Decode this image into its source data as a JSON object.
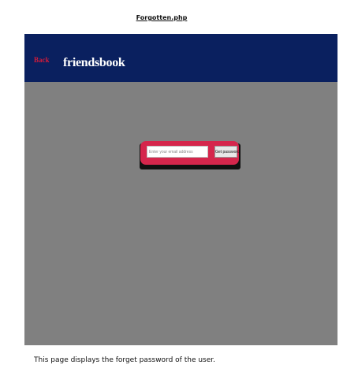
{
  "document": {
    "title": "Forgotten.php",
    "caption": "This page displays the forget password of the user."
  },
  "app": {
    "header": {
      "back_label": "Back",
      "logo": "friendsbook"
    },
    "form": {
      "email_placeholder": "Enter your email address",
      "email_value": "",
      "submit_label": "Get password"
    }
  },
  "colors": {
    "header_bg": "#0a205f",
    "page_bg": "#808080",
    "panel_bg": "#d5264c",
    "back_link": "#d21b3a"
  }
}
